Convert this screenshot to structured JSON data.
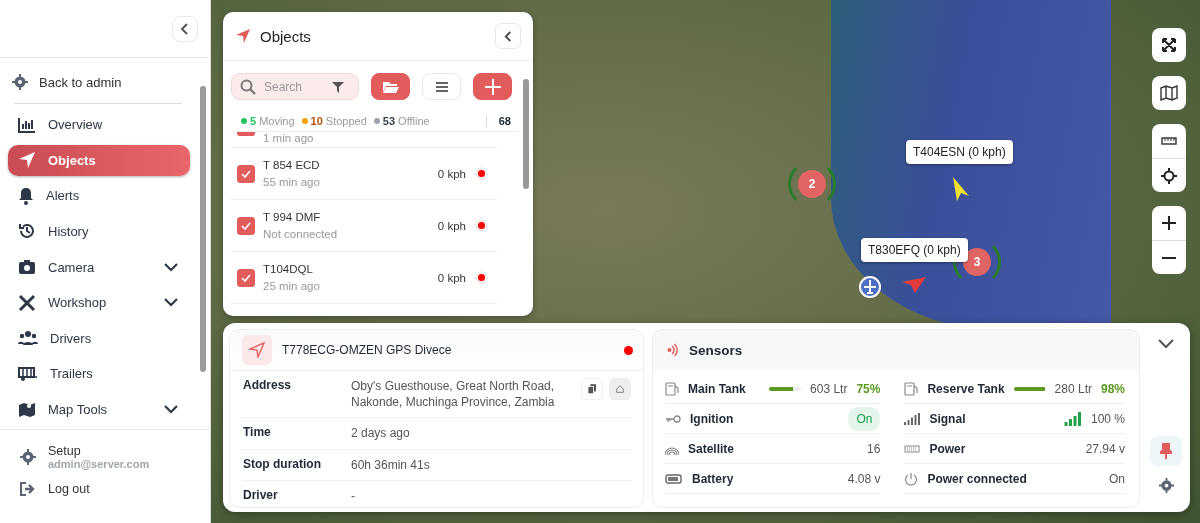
{
  "sidebar": {
    "back_link": "Back to admin",
    "items": [
      {
        "label": "Overview",
        "selected": false,
        "expandable": false
      },
      {
        "label": "Objects",
        "selected": true,
        "expandable": false
      },
      {
        "label": "Alerts",
        "selected": false,
        "expandable": false
      },
      {
        "label": "History",
        "selected": false,
        "expandable": false
      },
      {
        "label": "Camera",
        "selected": false,
        "expandable": true
      },
      {
        "label": "Workshop",
        "selected": false,
        "expandable": true
      },
      {
        "label": "Drivers",
        "selected": false,
        "expandable": false
      },
      {
        "label": "Trailers",
        "selected": false,
        "expandable": false
      },
      {
        "label": "Map Tools",
        "selected": false,
        "expandable": true
      }
    ],
    "setup": {
      "label": "Setup",
      "email": "admin@server.com"
    },
    "logout": "Log out"
  },
  "objects_panel": {
    "title": "Objects",
    "search": {
      "placeholder": "Search"
    },
    "summary": [
      {
        "count": "5",
        "label": "Moving",
        "color": "#22c55e"
      },
      {
        "count": "10",
        "label": "Stopped",
        "color": "#f59e0b"
      },
      {
        "count": "53",
        "label": "Offline",
        "color": "#9ca3af"
      }
    ],
    "total": "68",
    "rows": [
      {
        "time": "1 min ago",
        "checked": true
      },
      {
        "name": "T 854 ECD",
        "time": "55 min ago",
        "speed": "0 kph",
        "checked": true,
        "color": "#ff0000"
      },
      {
        "name": "T 994 DMF",
        "time": "Not connected",
        "speed": "0 kph",
        "checked": true,
        "color": "#ff0000"
      },
      {
        "name": "T104DQL",
        "time": "25 min ago",
        "speed": "0 kph",
        "checked": true,
        "color": "#ff0000"
      }
    ]
  },
  "map": {
    "tooltips": [
      "T404ESN (0 kph)",
      "T830EFQ (0 kph)"
    ],
    "clusters": [
      "2",
      "3"
    ]
  },
  "details": {
    "title": "T778ECG-OMZEN GPS Divece",
    "fields": [
      {
        "label": "Address",
        "value": "Oby's Guesthouse, Great North Road, Nakonde, Muchinga Province, Zambia",
        "actions": true
      },
      {
        "label": "Time",
        "value": "2 days ago",
        "actions": false
      },
      {
        "label": "Stop duration",
        "value": "60h 36min 41s",
        "actions": false
      },
      {
        "label": "Driver",
        "value": "-",
        "actions": false
      }
    ]
  },
  "sensors": {
    "title": "Sensors",
    "items": [
      {
        "kind": "gauge",
        "label": "Main Tank",
        "level": 0.75,
        "value": "603 Ltr",
        "percent": "75%"
      },
      {
        "kind": "gauge",
        "label": "Reserve Tank",
        "level": 0.98,
        "value": "280 Ltr",
        "percent": "98%"
      },
      {
        "kind": "badge",
        "label": "Ignition",
        "value": "On"
      },
      {
        "kind": "signal",
        "label": "Signal",
        "value": "100 %"
      },
      {
        "kind": "value",
        "label": "Satellite",
        "value": "16"
      },
      {
        "kind": "value",
        "label": "Power",
        "value": "27.94 v"
      },
      {
        "kind": "value",
        "label": "Battery",
        "value": "4.08 v"
      },
      {
        "kind": "value",
        "label": "Power connected",
        "value": "On"
      }
    ]
  }
}
